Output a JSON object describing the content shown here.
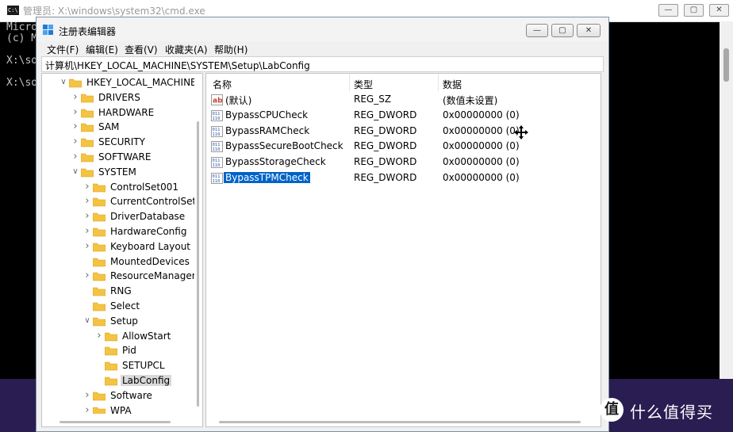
{
  "cmd": {
    "icon_text": "C:\\.",
    "title": "管理员: X:\\windows\\system32\\cmd.exe",
    "lines": [
      "Micro",
      "(c) M",
      "",
      "X:\\so",
      "",
      "X:\\so"
    ]
  },
  "regedit": {
    "title": "注册表编辑器",
    "menu": [
      "文件(F)",
      "编辑(E)",
      "查看(V)",
      "收藏夹(A)",
      "帮助(H)"
    ],
    "address": "计算机\\HKEY_LOCAL_MACHINE\\SYSTEM\\Setup\\LabConfig",
    "tree": [
      {
        "label": "HKEY_LOCAL_MACHINE",
        "level": 0,
        "expanded": true
      },
      {
        "label": "DRIVERS",
        "level": 1,
        "expanded": false
      },
      {
        "label": "HARDWARE",
        "level": 1,
        "expanded": false
      },
      {
        "label": "SAM",
        "level": 1,
        "expanded": false
      },
      {
        "label": "SECURITY",
        "level": 1,
        "expanded": false
      },
      {
        "label": "SOFTWARE",
        "level": 1,
        "expanded": false
      },
      {
        "label": "SYSTEM",
        "level": 1,
        "expanded": true
      },
      {
        "label": "ControlSet001",
        "level": 2,
        "expanded": false
      },
      {
        "label": "CurrentControlSet",
        "level": 2,
        "expanded": false
      },
      {
        "label": "DriverDatabase",
        "level": 2,
        "expanded": false
      },
      {
        "label": "HardwareConfig",
        "level": 2,
        "expanded": false
      },
      {
        "label": "Keyboard Layout",
        "level": 2,
        "expanded": false
      },
      {
        "label": "MountedDevices",
        "level": 2,
        "expanded": null
      },
      {
        "label": "ResourceManager",
        "level": 2,
        "expanded": false
      },
      {
        "label": "RNG",
        "level": 2,
        "expanded": null
      },
      {
        "label": "Select",
        "level": 2,
        "expanded": null
      },
      {
        "label": "Setup",
        "level": 2,
        "expanded": true
      },
      {
        "label": "AllowStart",
        "level": 3,
        "expanded": false
      },
      {
        "label": "Pid",
        "level": 3,
        "expanded": null
      },
      {
        "label": "SETUPCL",
        "level": 3,
        "expanded": null
      },
      {
        "label": "LabConfig",
        "level": 3,
        "expanded": null,
        "selected": true
      },
      {
        "label": "Software",
        "level": 2,
        "expanded": false
      },
      {
        "label": "WPA",
        "level": 2,
        "expanded": false
      }
    ],
    "columns": [
      "名称",
      "类型",
      "数据"
    ],
    "values": [
      {
        "name": "(默认)",
        "type": "REG_SZ",
        "data": "(数值未设置)",
        "icon": "string-value-icon"
      },
      {
        "name": "BypassCPUCheck",
        "type": "REG_DWORD",
        "data": "0x00000000 (0)",
        "icon": "dword-value-icon"
      },
      {
        "name": "BypassRAMCheck",
        "type": "REG_DWORD",
        "data": "0x00000000 (0)",
        "icon": "dword-value-icon"
      },
      {
        "name": "BypassSecureBootCheck",
        "type": "REG_DWORD",
        "data": "0x00000000 (0)",
        "icon": "dword-value-icon"
      },
      {
        "name": "BypassStorageCheck",
        "type": "REG_DWORD",
        "data": "0x00000000 (0)",
        "icon": "dword-value-icon"
      },
      {
        "name": "BypassTPMCheck",
        "type": "REG_DWORD",
        "data": "0x00000000 (0)",
        "icon": "dword-value-icon",
        "selected": true
      }
    ]
  },
  "watermark": {
    "logo": "值",
    "text": "什么值得买"
  },
  "colors": {
    "selection": "#0063c8",
    "folder": "#f5c342",
    "desktop": "#2a1d52"
  }
}
